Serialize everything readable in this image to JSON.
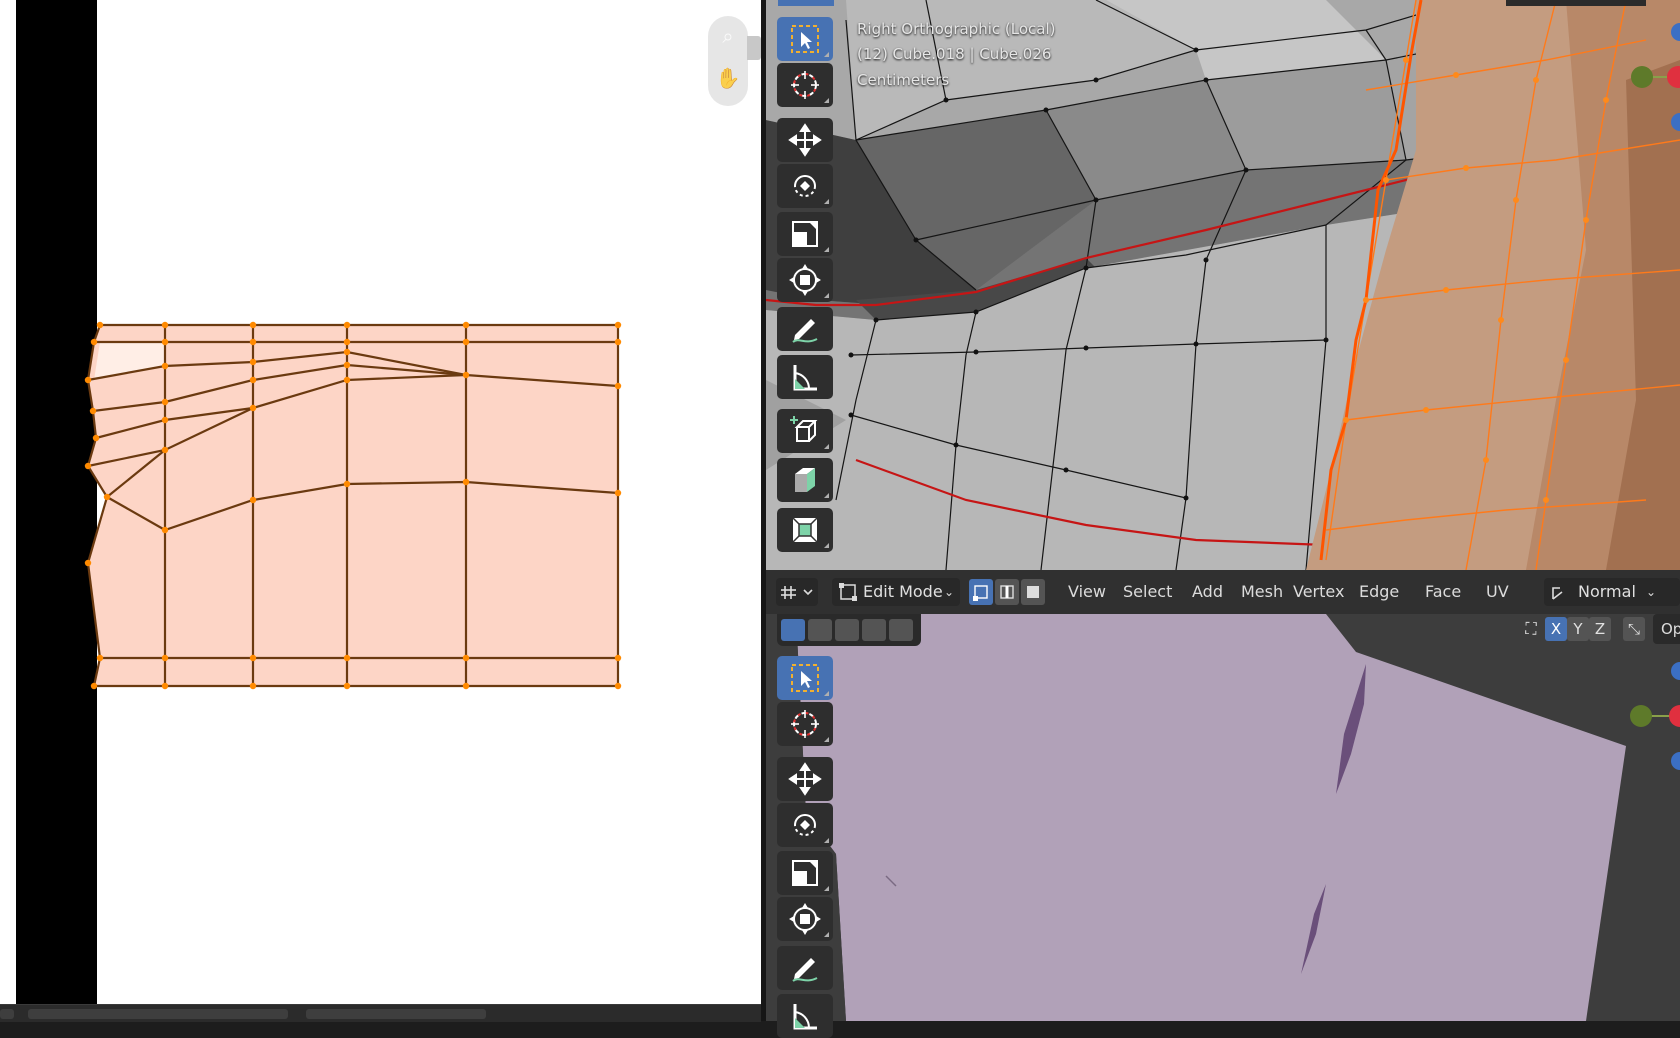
{
  "colors": {
    "uv_face": "#fdd5c6",
    "uv_edge": "#6b3a10",
    "uv_vertex": "#ff8a00",
    "mesh_light": "#bdbdbd",
    "mesh_orange": "#c89a7c",
    "seam": "#cc1a1a",
    "active_tool": "#4772b3",
    "lavender_face": "#b1a1b8"
  },
  "uv_editor": {
    "navigation": {
      "icons": [
        "zoom-icon",
        "hand-pan-icon"
      ]
    }
  },
  "viewport_top": {
    "overlay": {
      "view_name": "Right Orthographic (Local)",
      "object_info": "(12) Cube.018 | Cube.026",
      "units": "Centimeters"
    }
  },
  "toolbar_top": {
    "tools": [
      "select-box-icon",
      "cursor-icon",
      "move-icon",
      "rotate-icon",
      "scale-icon",
      "transform-icon",
      "annotate-icon",
      "measure-icon",
      "add-cube-icon",
      "extrude-region-icon",
      "inset-faces-icon"
    ]
  },
  "header": {
    "mode": "Edit Mode",
    "menus": [
      "View",
      "Select",
      "Add",
      "Mesh",
      "Vertex",
      "Edge",
      "Face",
      "UV"
    ],
    "orientation": "Normal",
    "axes": [
      "X",
      "Y",
      "Z"
    ],
    "overlay_partial": "Op"
  },
  "toolbar_bottom": {
    "tools": [
      "select-box-icon",
      "cursor-icon",
      "move-icon",
      "rotate-icon",
      "scale-icon",
      "transform-icon",
      "annotate-icon",
      "measure-icon"
    ]
  }
}
